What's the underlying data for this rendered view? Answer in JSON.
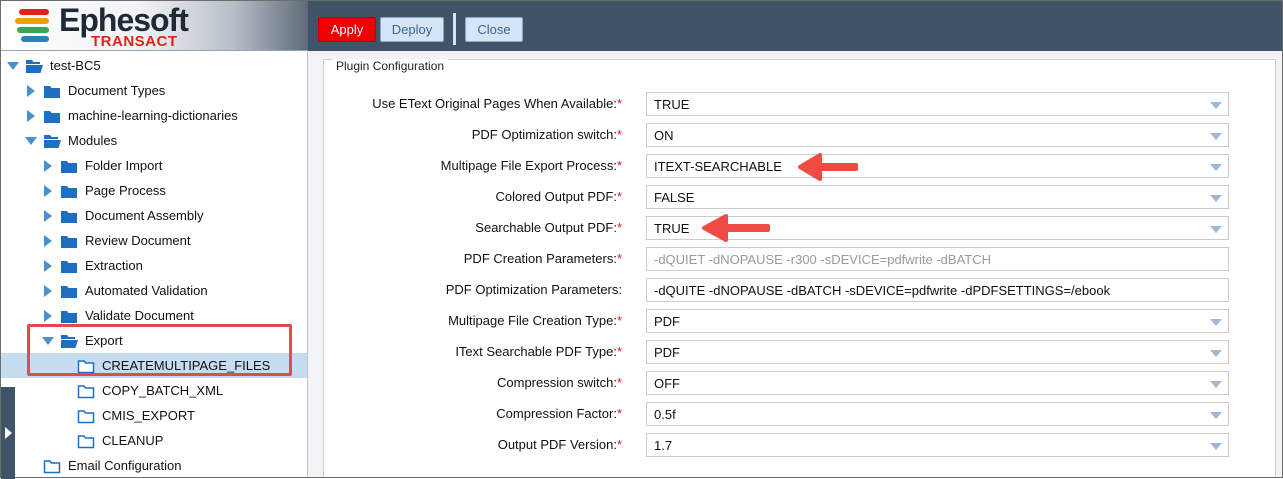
{
  "app": {
    "logo_text": "Ephesoft",
    "logo_sub": "TRANSACT"
  },
  "toolbar": {
    "apply_label": "Apply",
    "deploy_label": "Deploy",
    "close_label": "Close"
  },
  "tree": [
    {
      "label": "test-BC5",
      "level": 0,
      "expander": "down",
      "icon": "folder-open-icon"
    },
    {
      "label": "Document Types",
      "level": 1,
      "expander": "right",
      "icon": "folder-icon"
    },
    {
      "label": "machine-learning-dictionaries",
      "level": 1,
      "expander": "right",
      "icon": "folder-icon"
    },
    {
      "label": "Modules",
      "level": 1,
      "expander": "down",
      "icon": "folder-open-icon"
    },
    {
      "label": "Folder Import",
      "level": 2,
      "expander": "right",
      "icon": "folder-icon"
    },
    {
      "label": "Page Process",
      "level": 2,
      "expander": "right",
      "icon": "folder-icon"
    },
    {
      "label": "Document Assembly",
      "level": 2,
      "expander": "right",
      "icon": "folder-icon"
    },
    {
      "label": "Review Document",
      "level": 2,
      "expander": "right",
      "icon": "folder-icon"
    },
    {
      "label": "Extraction",
      "level": 2,
      "expander": "right",
      "icon": "folder-icon"
    },
    {
      "label": "Automated Validation",
      "level": 2,
      "expander": "right",
      "icon": "folder-icon"
    },
    {
      "label": "Validate Document",
      "level": 2,
      "expander": "right",
      "icon": "folder-icon"
    },
    {
      "label": "Export",
      "level": 2,
      "expander": "down",
      "icon": "folder-open-icon"
    },
    {
      "label": "CREATEMULTIPAGE_FILES",
      "level": 3,
      "expander": "none",
      "icon": "folder-outline-icon",
      "selected": true
    },
    {
      "label": "COPY_BATCH_XML",
      "level": 3,
      "expander": "none",
      "icon": "folder-outline-icon"
    },
    {
      "label": "CMIS_EXPORT",
      "level": 3,
      "expander": "none",
      "icon": "folder-outline-icon"
    },
    {
      "label": "CLEANUP",
      "level": 3,
      "expander": "none",
      "icon": "folder-outline-icon"
    },
    {
      "label": "Email Configuration",
      "level": 1,
      "expander": "none",
      "icon": "folder-outline-icon"
    }
  ],
  "panel": {
    "title": "Plugin Configuration",
    "required_mark": "*",
    "fields": [
      {
        "label": "Use EText Original Pages When Available:",
        "required": true,
        "value": "TRUE",
        "type": "select"
      },
      {
        "label": "PDF Optimization switch:",
        "required": true,
        "value": "ON",
        "type": "select"
      },
      {
        "label": "Multipage File Export Process:",
        "required": true,
        "value": "ITEXT-SEARCHABLE",
        "type": "select",
        "annotated": true
      },
      {
        "label": "Colored Output PDF:",
        "required": true,
        "value": "FALSE",
        "type": "select"
      },
      {
        "label": "Searchable Output PDF:",
        "required": true,
        "value": "TRUE",
        "type": "select",
        "annotated": true
      },
      {
        "label": "PDF Creation Parameters:",
        "required": true,
        "value": "-dQUIET -dNOPAUSE -r300 -sDEVICE=pdfwrite -dBATCH",
        "type": "text",
        "disabled": true
      },
      {
        "label": "PDF Optimization Parameters:",
        "required": false,
        "value": "-dQUITE -dNOPAUSE -dBATCH -sDEVICE=pdfwrite -dPDFSETTINGS=/ebook",
        "type": "text"
      },
      {
        "label": "Multipage File Creation Type:",
        "required": true,
        "value": "PDF",
        "type": "select"
      },
      {
        "label": "IText Searchable PDF Type:",
        "required": true,
        "value": "PDF",
        "type": "select"
      },
      {
        "label": "Compression switch:",
        "required": true,
        "value": "OFF",
        "type": "select"
      },
      {
        "label": "Compression Factor:",
        "required": true,
        "value": "0.5f",
        "type": "select"
      },
      {
        "label": "Output PDF Version:",
        "required": true,
        "value": "1.7",
        "type": "select"
      }
    ]
  },
  "colors": {
    "toolbar_bg": "#3f5369",
    "apply_bg": "#ee0000",
    "button_bg": "#d4e6f6",
    "selected_row": "#c6ddf1",
    "annotation": "#e5484d",
    "tree_icon": "#1f6fc1"
  }
}
